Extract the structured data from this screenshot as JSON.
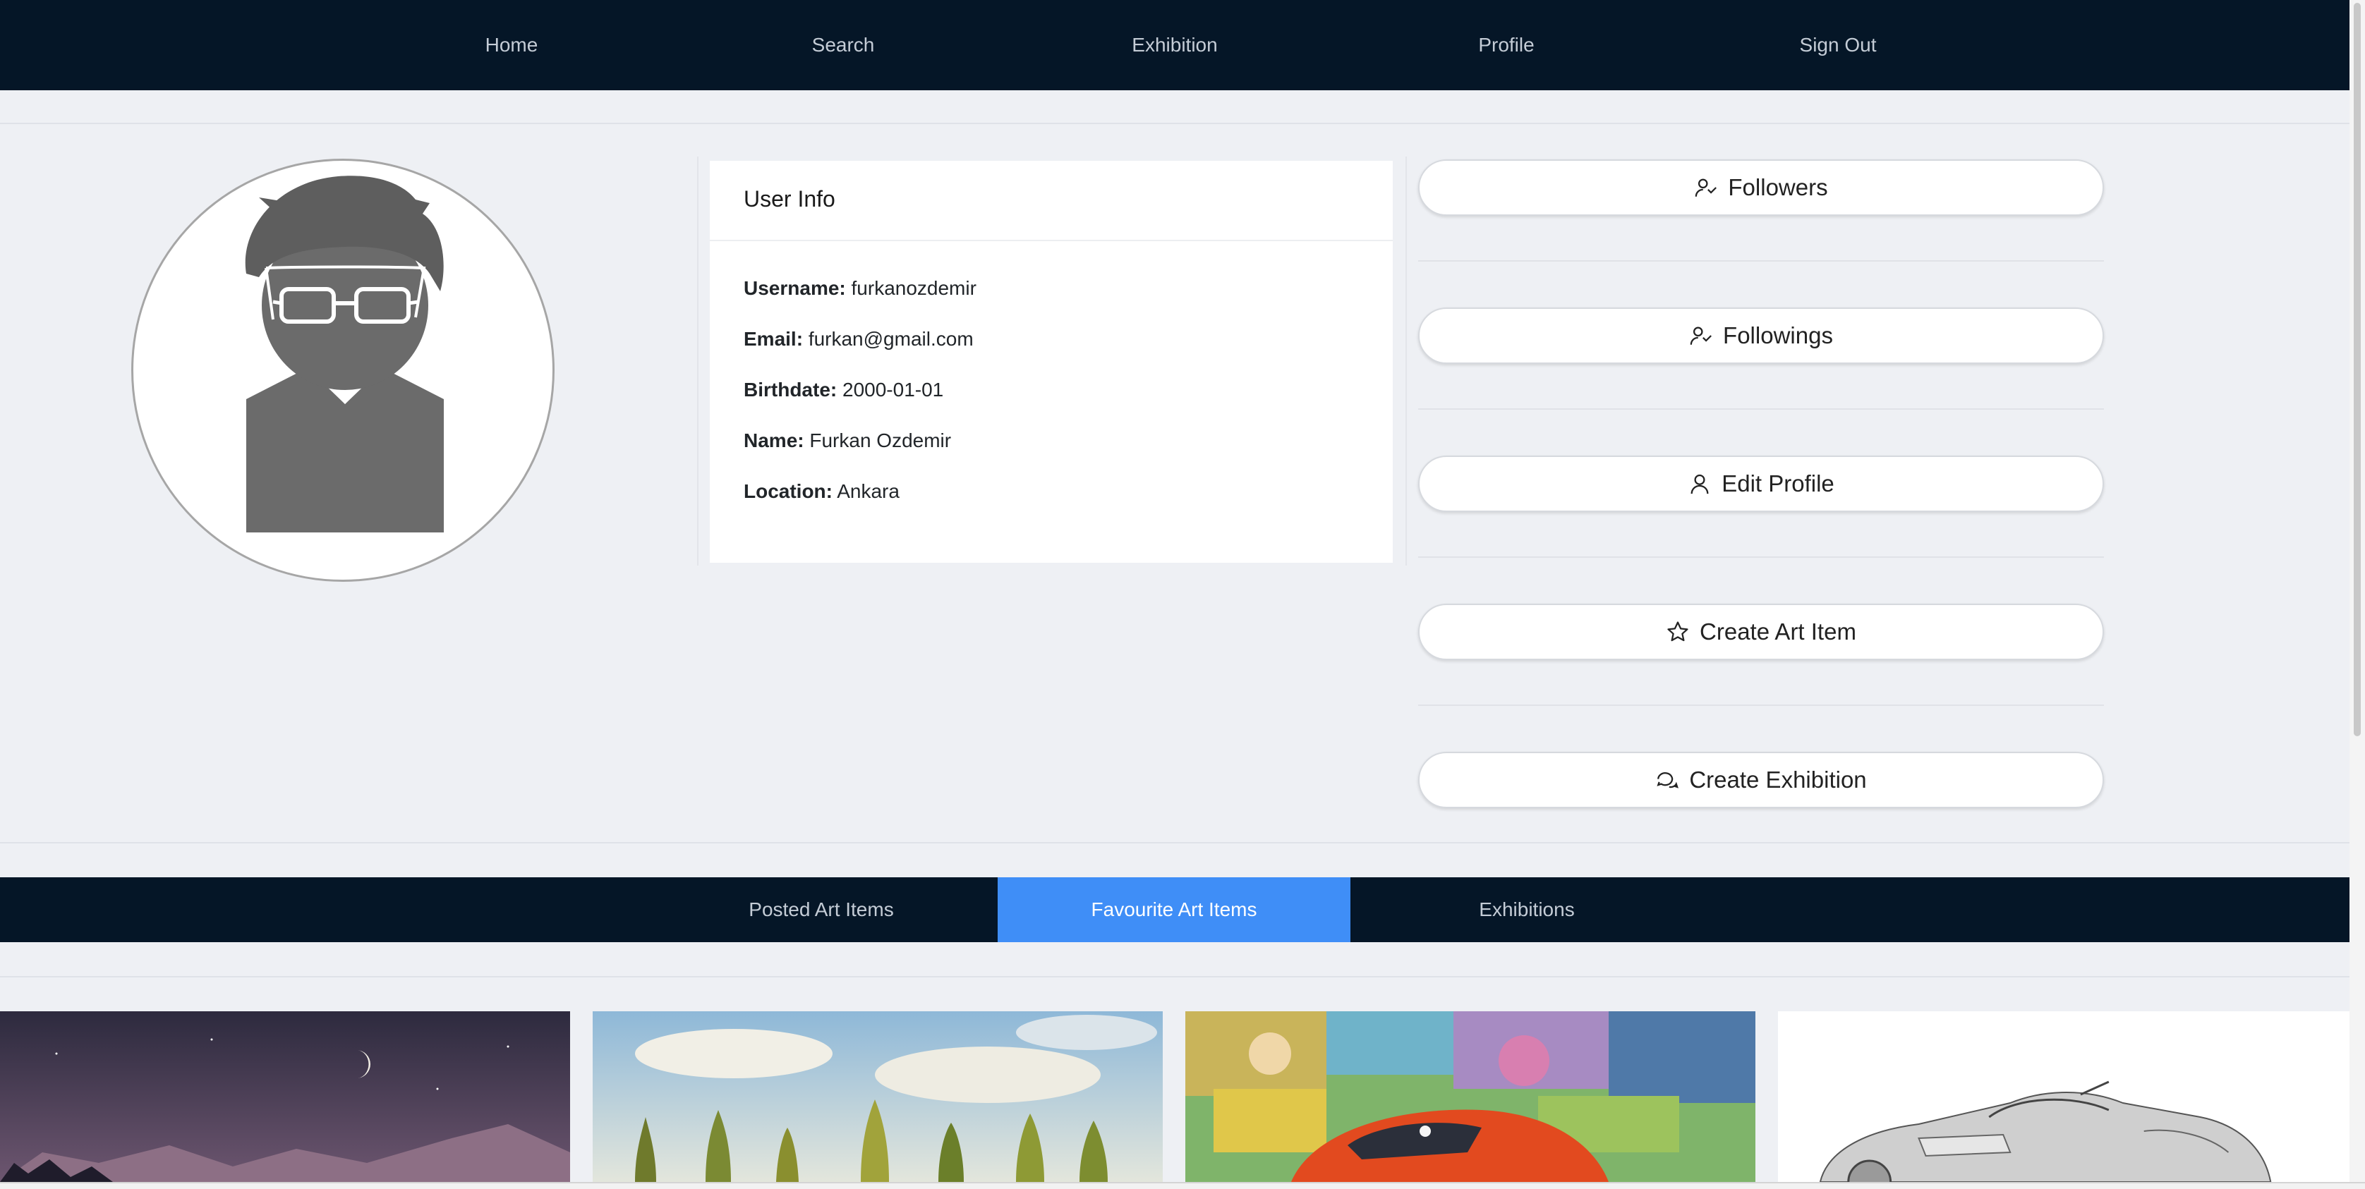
{
  "nav": {
    "items": [
      {
        "label": "Home"
      },
      {
        "label": "Search"
      },
      {
        "label": "Exhibition"
      },
      {
        "label": "Profile"
      },
      {
        "label": "Sign Out"
      }
    ]
  },
  "user_info": {
    "title": "User Info",
    "fields": [
      {
        "label": "Username:",
        "value": "furkanozdemir"
      },
      {
        "label": "Email:",
        "value": "furkan@gmail.com"
      },
      {
        "label": "Birthdate:",
        "value": "2000-01-01"
      },
      {
        "label": "Name:",
        "value": "Furkan Ozdemir"
      },
      {
        "label": "Location:",
        "value": "Ankara"
      }
    ]
  },
  "actions": [
    {
      "label": "Followers",
      "icon": "followers-icon"
    },
    {
      "label": "Followings",
      "icon": "followings-icon"
    },
    {
      "label": "Edit Profile",
      "icon": "user-icon"
    },
    {
      "label": "Create Art Item",
      "icon": "star-icon"
    },
    {
      "label": "Create Exhibition",
      "icon": "chat-bubbles-icon"
    }
  ],
  "tabs": [
    {
      "label": "Posted Art Items",
      "active": false
    },
    {
      "label": "Favourite Art Items",
      "active": true
    },
    {
      "label": "Exhibitions",
      "active": false
    }
  ],
  "gallery": [
    {
      "image": "night-mountains-moon"
    },
    {
      "image": "painted-trees-sky"
    },
    {
      "image": "colorful-abstract-car"
    },
    {
      "image": "pencil-sketch-car"
    }
  ],
  "colors": {
    "navbar": "#051627",
    "active_tab": "#3f8ef7",
    "background": "#eef0f4"
  }
}
